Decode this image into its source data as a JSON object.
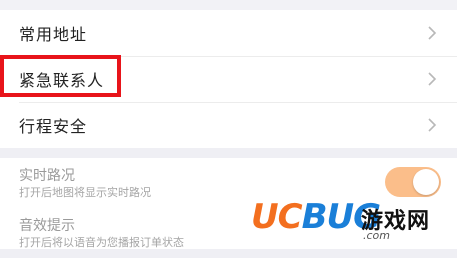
{
  "menu": {
    "items": [
      {
        "label": "常用地址"
      },
      {
        "label": "紧急联系人"
      },
      {
        "label": "行程安全"
      }
    ]
  },
  "settings": {
    "items": [
      {
        "title": "实时路况",
        "subtitle": "打开后地图将显示实时路况",
        "enabled": true
      },
      {
        "title": "音效提示",
        "subtitle": "打开后将以语音为您播报订单状态",
        "enabled": true
      }
    ]
  },
  "watermark": {
    "brand_uc": "UC",
    "brand_bug": "BUG",
    "brand_cn": "游戏网",
    "brand_sub": ".com"
  },
  "colors": {
    "accent": "#f7861e",
    "highlight": "#e8141a",
    "toggle_on": "#fbbe8a"
  }
}
